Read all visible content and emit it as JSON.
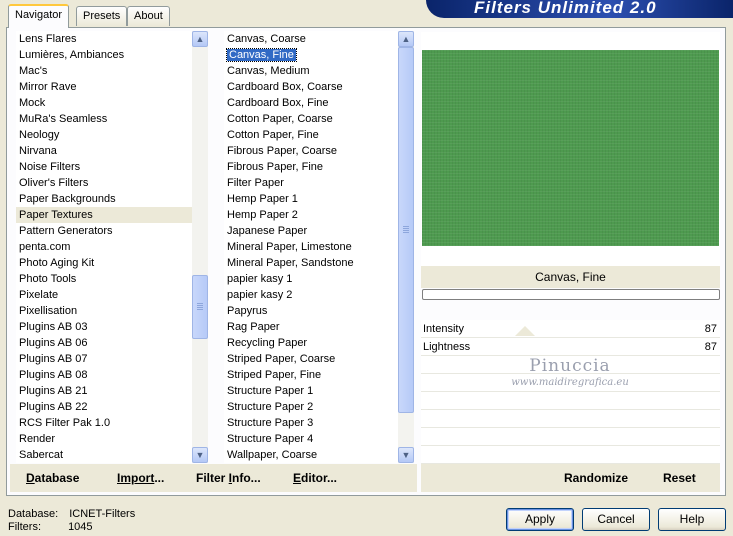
{
  "tabs": [
    {
      "label": "Navigator",
      "active": true
    },
    {
      "label": "Presets",
      "active": false
    },
    {
      "label": "About",
      "active": false
    }
  ],
  "app_title": "Filters Unlimited 2.0",
  "categories": {
    "items": [
      "Lens Flares",
      "Lumières, Ambiances",
      "Mac's",
      "Mirror Rave",
      "Mock",
      "MuRa's Seamless",
      "Neology",
      "Nirvana",
      "Noise Filters",
      "Oliver's Filters",
      "Paper Backgrounds",
      "Paper Textures",
      "Pattern Generators",
      "penta.com",
      "Photo Aging Kit",
      "Photo Tools",
      "Pixelate",
      "Pixellisation",
      "Plugins AB 03",
      "Plugins AB 06",
      "Plugins AB 07",
      "Plugins AB 08",
      "Plugins AB 21",
      "Plugins AB 22",
      "RCS Filter Pak 1.0",
      "Render",
      "Sabercat"
    ],
    "selected": "Paper Textures"
  },
  "filters": {
    "items": [
      "Canvas, Coarse",
      "Canvas, Fine",
      "Canvas, Medium",
      "Cardboard Box, Coarse",
      "Cardboard Box, Fine",
      "Cotton Paper, Coarse",
      "Cotton Paper, Fine",
      "Fibrous Paper, Coarse",
      "Fibrous Paper, Fine",
      "Filter Paper",
      "Hemp Paper 1",
      "Hemp Paper 2",
      "Japanese Paper",
      "Mineral Paper, Limestone",
      "Mineral Paper, Sandstone",
      "papier kasy 1",
      "papier kasy 2",
      "Papyrus",
      "Rag Paper",
      "Recycling Paper",
      "Striped Paper, Coarse",
      "Striped Paper, Fine",
      "Structure Paper 1",
      "Structure Paper 2",
      "Structure Paper 3",
      "Structure Paper 4",
      "Wallpaper, Coarse"
    ],
    "selected": "Canvas, Fine"
  },
  "links": {
    "database": {
      "first": "D",
      "rest": "atabase"
    },
    "import": {
      "first": "Import",
      "rest": "..."
    },
    "filter_info": {
      "first": "Filter ",
      "u": "I",
      "rest": "nfo..."
    },
    "editor": {
      "first": "E",
      "rest": "ditor..."
    }
  },
  "preview": {
    "color": "#4e9a4f",
    "filter_name": "Canvas, Fine",
    "progress": 0
  },
  "params": [
    {
      "label": "Intensity",
      "value": "87"
    },
    {
      "label": "Lightness",
      "value": "87"
    }
  ],
  "watermark": {
    "line1": "Pinuccia",
    "line2": "www.maidiregrafica.eu"
  },
  "randomize_label": "Randomize",
  "reset_label": "Reset",
  "status": {
    "database_label": "Database:",
    "database_value": "ICNET-Filters",
    "filters_label": "Filters:",
    "filters_value": "1045"
  },
  "buttons": {
    "apply": "Apply",
    "cancel": "Cancel",
    "help": "Help"
  },
  "scroll": {
    "categories_thumb": 0.68,
    "filters_thumb": 0.0
  }
}
